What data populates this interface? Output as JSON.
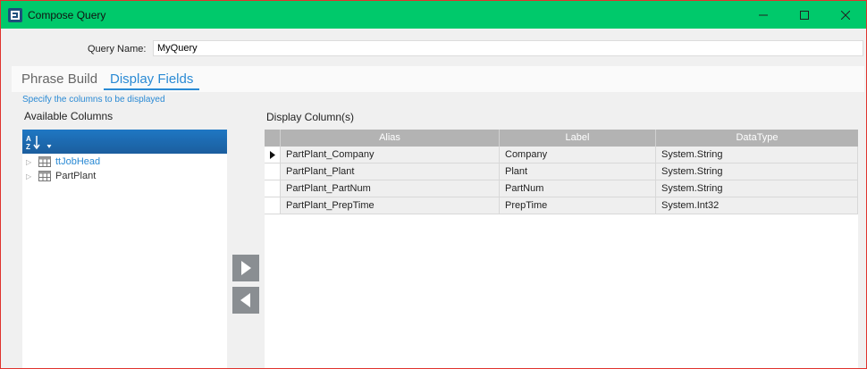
{
  "window": {
    "title": "Compose Query",
    "titlebar_color": "#00c96b",
    "border_color": "#e0332d",
    "icons": [
      "app-e-icon",
      "minimize-icon",
      "maximize-icon",
      "close-icon"
    ]
  },
  "query": {
    "label": "Query Name:",
    "value": "MyQuery"
  },
  "tabs": [
    {
      "label": "Phrase Build",
      "active": false
    },
    {
      "label": "Display Fields",
      "active": true
    }
  ],
  "hint": "Specify the columns to be displayed",
  "available": {
    "title": "Available Columns",
    "sort_icon": "sort-az-icon",
    "items": [
      {
        "label": "ttJobHead",
        "highlighted": true
      },
      {
        "label": "PartPlant",
        "highlighted": false
      }
    ]
  },
  "move_buttons": {
    "right_icon": "arrow-right-icon",
    "left_icon": "arrow-left-icon"
  },
  "display": {
    "title": "Display Column(s)",
    "columns": [
      "Alias",
      "Label",
      "DataType"
    ],
    "rows": [
      {
        "alias": "PartPlant_Company",
        "label": "Company",
        "datatype": "System.String",
        "current": true
      },
      {
        "alias": "PartPlant_Plant",
        "label": "Plant",
        "datatype": "System.String",
        "current": false
      },
      {
        "alias": "PartPlant_PartNum",
        "label": "PartNum",
        "datatype": "System.String",
        "current": false
      },
      {
        "alias": "PartPlant_PrepTime",
        "label": "PrepTime",
        "datatype": "System.Int32",
        "current": false
      }
    ]
  },
  "accent_color": "#2a8ad4"
}
